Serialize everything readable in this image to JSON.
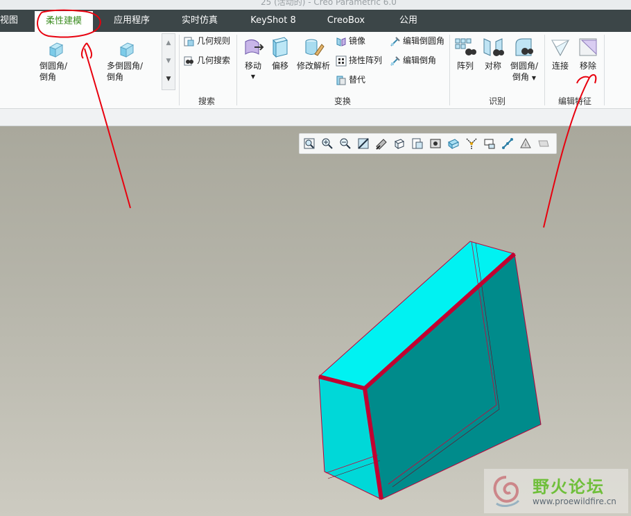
{
  "window": {
    "title": "25 (活动的) - Creo Parametric 6.0"
  },
  "tabs": [
    {
      "label": "视图",
      "active": false
    },
    {
      "label": "柔性建模",
      "active": true
    },
    {
      "label": "应用程序",
      "active": false
    },
    {
      "label": "实时仿真",
      "active": false
    },
    {
      "label": "KeyShot 8",
      "active": false
    },
    {
      "label": "CreoBox",
      "active": false
    },
    {
      "label": "公用",
      "active": false
    }
  ],
  "ribbon": {
    "round_chamfer": {
      "line1": "倒圆角/",
      "line2": "倒角"
    },
    "multi_round_chamfer": {
      "line1": "多倒圆角/",
      "line2": "倒角"
    },
    "search_group": {
      "label": "搜索",
      "geometry_rules": "几何规则",
      "geometry_search": "几何搜索"
    },
    "transform_group": {
      "label": "变换",
      "move": "移动",
      "offset": "偏移",
      "modify_analytic": "修改解析",
      "mirror": "镜像",
      "flexible_pattern": "挠性阵列",
      "substitute": "替代",
      "edit_round": "编辑倒圆角",
      "edit_chamfer": "编辑倒角"
    },
    "recognize_group": {
      "label": "识别",
      "pattern": "阵列",
      "symmetry": "对称",
      "round_chamfer_line1": "倒圆角/",
      "round_chamfer_line2": "倒角"
    },
    "edit_feature_group": {
      "label": "编辑特征",
      "attach": "连接",
      "remove": "移除"
    }
  },
  "colors": {
    "tabbar_bg": "#3c4648",
    "active_tab_text": "#3a8b1e",
    "model_face_light": "#00f2f2",
    "model_face_dark": "#008b8b",
    "edge_highlight": "#d0002a",
    "annotation_red": "#e8000e"
  },
  "view_toolbar": {
    "icons": [
      "refit-icon",
      "zoom-in-icon",
      "zoom-out-icon",
      "repaint-icon",
      "display-style-icon",
      "saved-orientations-icon",
      "view-manager-icon",
      "perspective-icon",
      "datum-display-icon",
      "spin-center-icon",
      "annotation-display-icon",
      "point-display-icon",
      "csys-display-icon",
      "sketch-display-icon"
    ]
  },
  "watermark": {
    "name": "野火论坛",
    "url": "www.proewildfire.cn"
  }
}
